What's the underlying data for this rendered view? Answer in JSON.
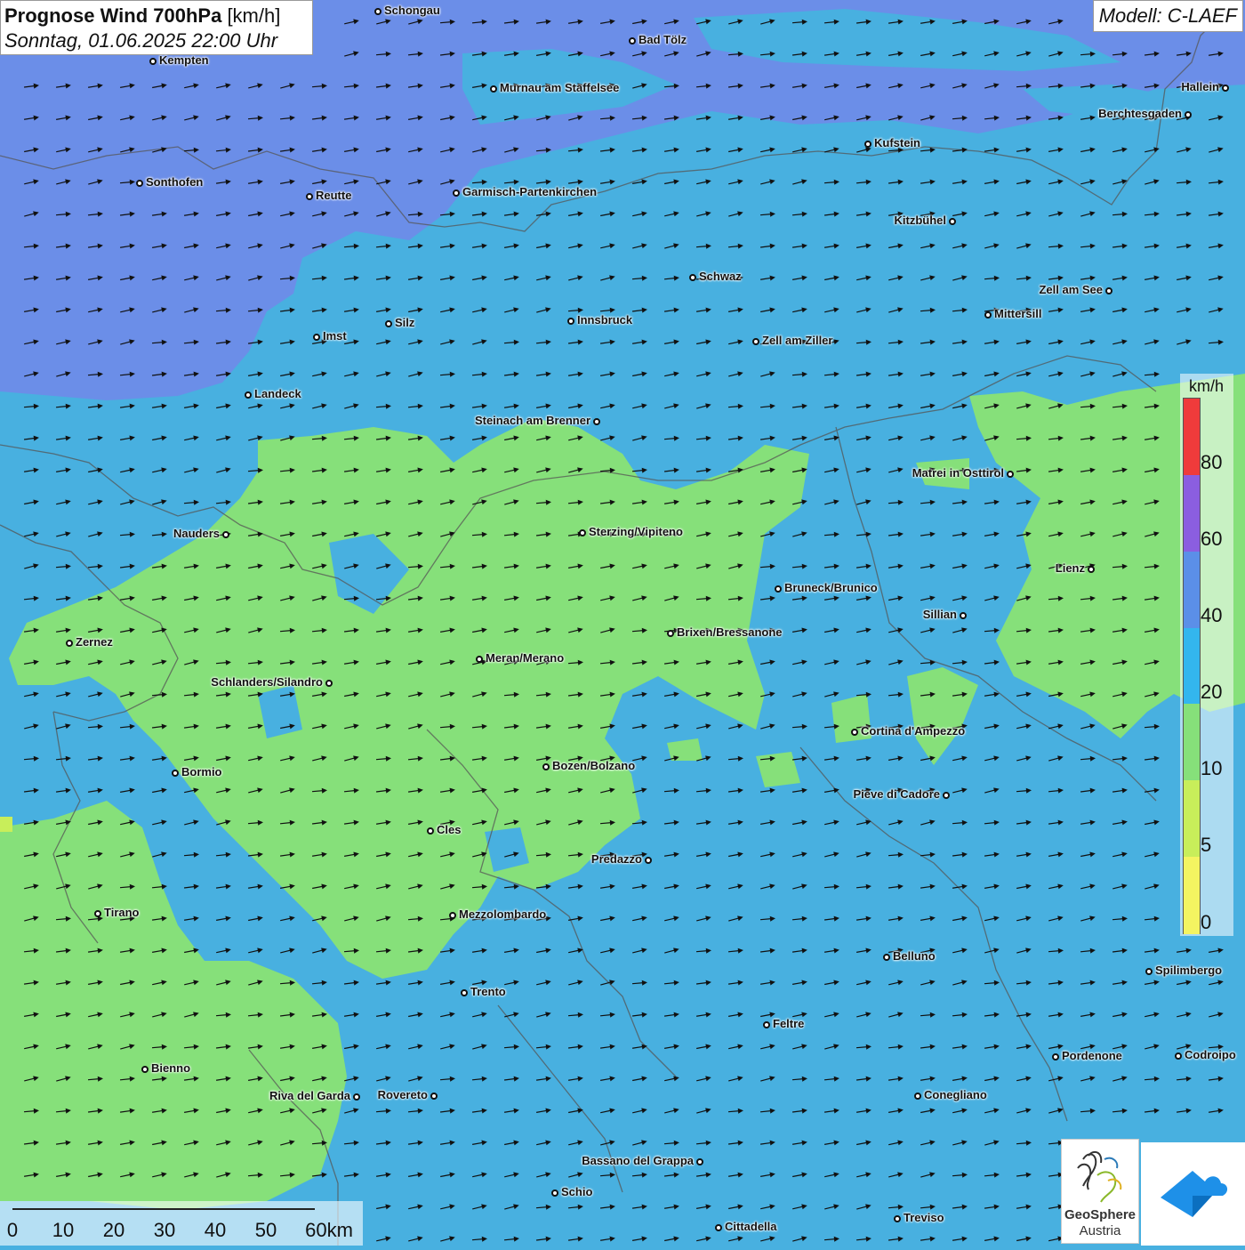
{
  "title": {
    "main": "Prognose Wind 700hPa",
    "unit": "[km/h]",
    "datetime": "Sonntag, 01.06.2025 22:00 Uhr"
  },
  "model": "Modell: C-LAEF",
  "legend": {
    "unit": "km/h",
    "ticks": [
      "80",
      "60",
      "40",
      "20",
      "10",
      "5",
      "0"
    ],
    "colors": [
      "#ef3b3b",
      "#8b5ee0",
      "#5b8fe8",
      "#33b6ee",
      "#86e07a",
      "#c8ee5a",
      "#f4f461"
    ]
  },
  "scale": {
    "labels": [
      "0",
      "10",
      "20",
      "30",
      "40",
      "50",
      "60km"
    ]
  },
  "logo": {
    "line1": "GeoSphere",
    "line2": "Austria"
  },
  "wind": {
    "direction": "from west, slightly south-west",
    "arrow_color": "#111111"
  },
  "colors": {
    "speed_10_20": "#86e07a",
    "speed_20_40": "#48b0e0",
    "speed_40_60": "#6b8ee8"
  },
  "cities": [
    {
      "name": "Schongau"
    },
    {
      "name": "Bad Tölz"
    },
    {
      "name": "Kempten"
    },
    {
      "name": "Murnau am Staffelsee"
    },
    {
      "name": "Hallein"
    },
    {
      "name": "Berchtesgaden"
    },
    {
      "name": "Kufstein"
    },
    {
      "name": "Sonthofen"
    },
    {
      "name": "Reutte"
    },
    {
      "name": "Garmisch-Partenkirchen"
    },
    {
      "name": "Kitzbühel"
    },
    {
      "name": "Schwaz"
    },
    {
      "name": "Zell am See"
    },
    {
      "name": "Mittersill"
    },
    {
      "name": "Silz"
    },
    {
      "name": "Innsbruck"
    },
    {
      "name": "Imst"
    },
    {
      "name": "Zell am Ziller"
    },
    {
      "name": "Landeck"
    },
    {
      "name": "Steinach am Brenner"
    },
    {
      "name": "Matrei in Osttirol"
    },
    {
      "name": "Nauders"
    },
    {
      "name": "Sterzing/Vipiteno"
    },
    {
      "name": "Lienz"
    },
    {
      "name": "Bruneck/Brunico"
    },
    {
      "name": "Sillian"
    },
    {
      "name": "Brixen/Bressanone"
    },
    {
      "name": "Zernez"
    },
    {
      "name": "Meran/Merano"
    },
    {
      "name": "Schlanders/Silandro"
    },
    {
      "name": "Cortina d'Ampezzo"
    },
    {
      "name": "Bormio"
    },
    {
      "name": "Bozen/Bolzano"
    },
    {
      "name": "Pieve di Cadore"
    },
    {
      "name": "Cles"
    },
    {
      "name": "Predazzo"
    },
    {
      "name": "Tirano"
    },
    {
      "name": "Mezzolombardo"
    },
    {
      "name": "Belluno"
    },
    {
      "name": "Spilimbergo"
    },
    {
      "name": "Trento"
    },
    {
      "name": "Feltre"
    },
    {
      "name": "Pordenone"
    },
    {
      "name": "Codroipo"
    },
    {
      "name": "Bienno"
    },
    {
      "name": "Riva del Garda"
    },
    {
      "name": "Rovereto"
    },
    {
      "name": "Conegliano"
    },
    {
      "name": "Bassano del Grappa"
    },
    {
      "name": "Schio"
    },
    {
      "name": "Treviso"
    },
    {
      "name": "Cittadella"
    }
  ]
}
